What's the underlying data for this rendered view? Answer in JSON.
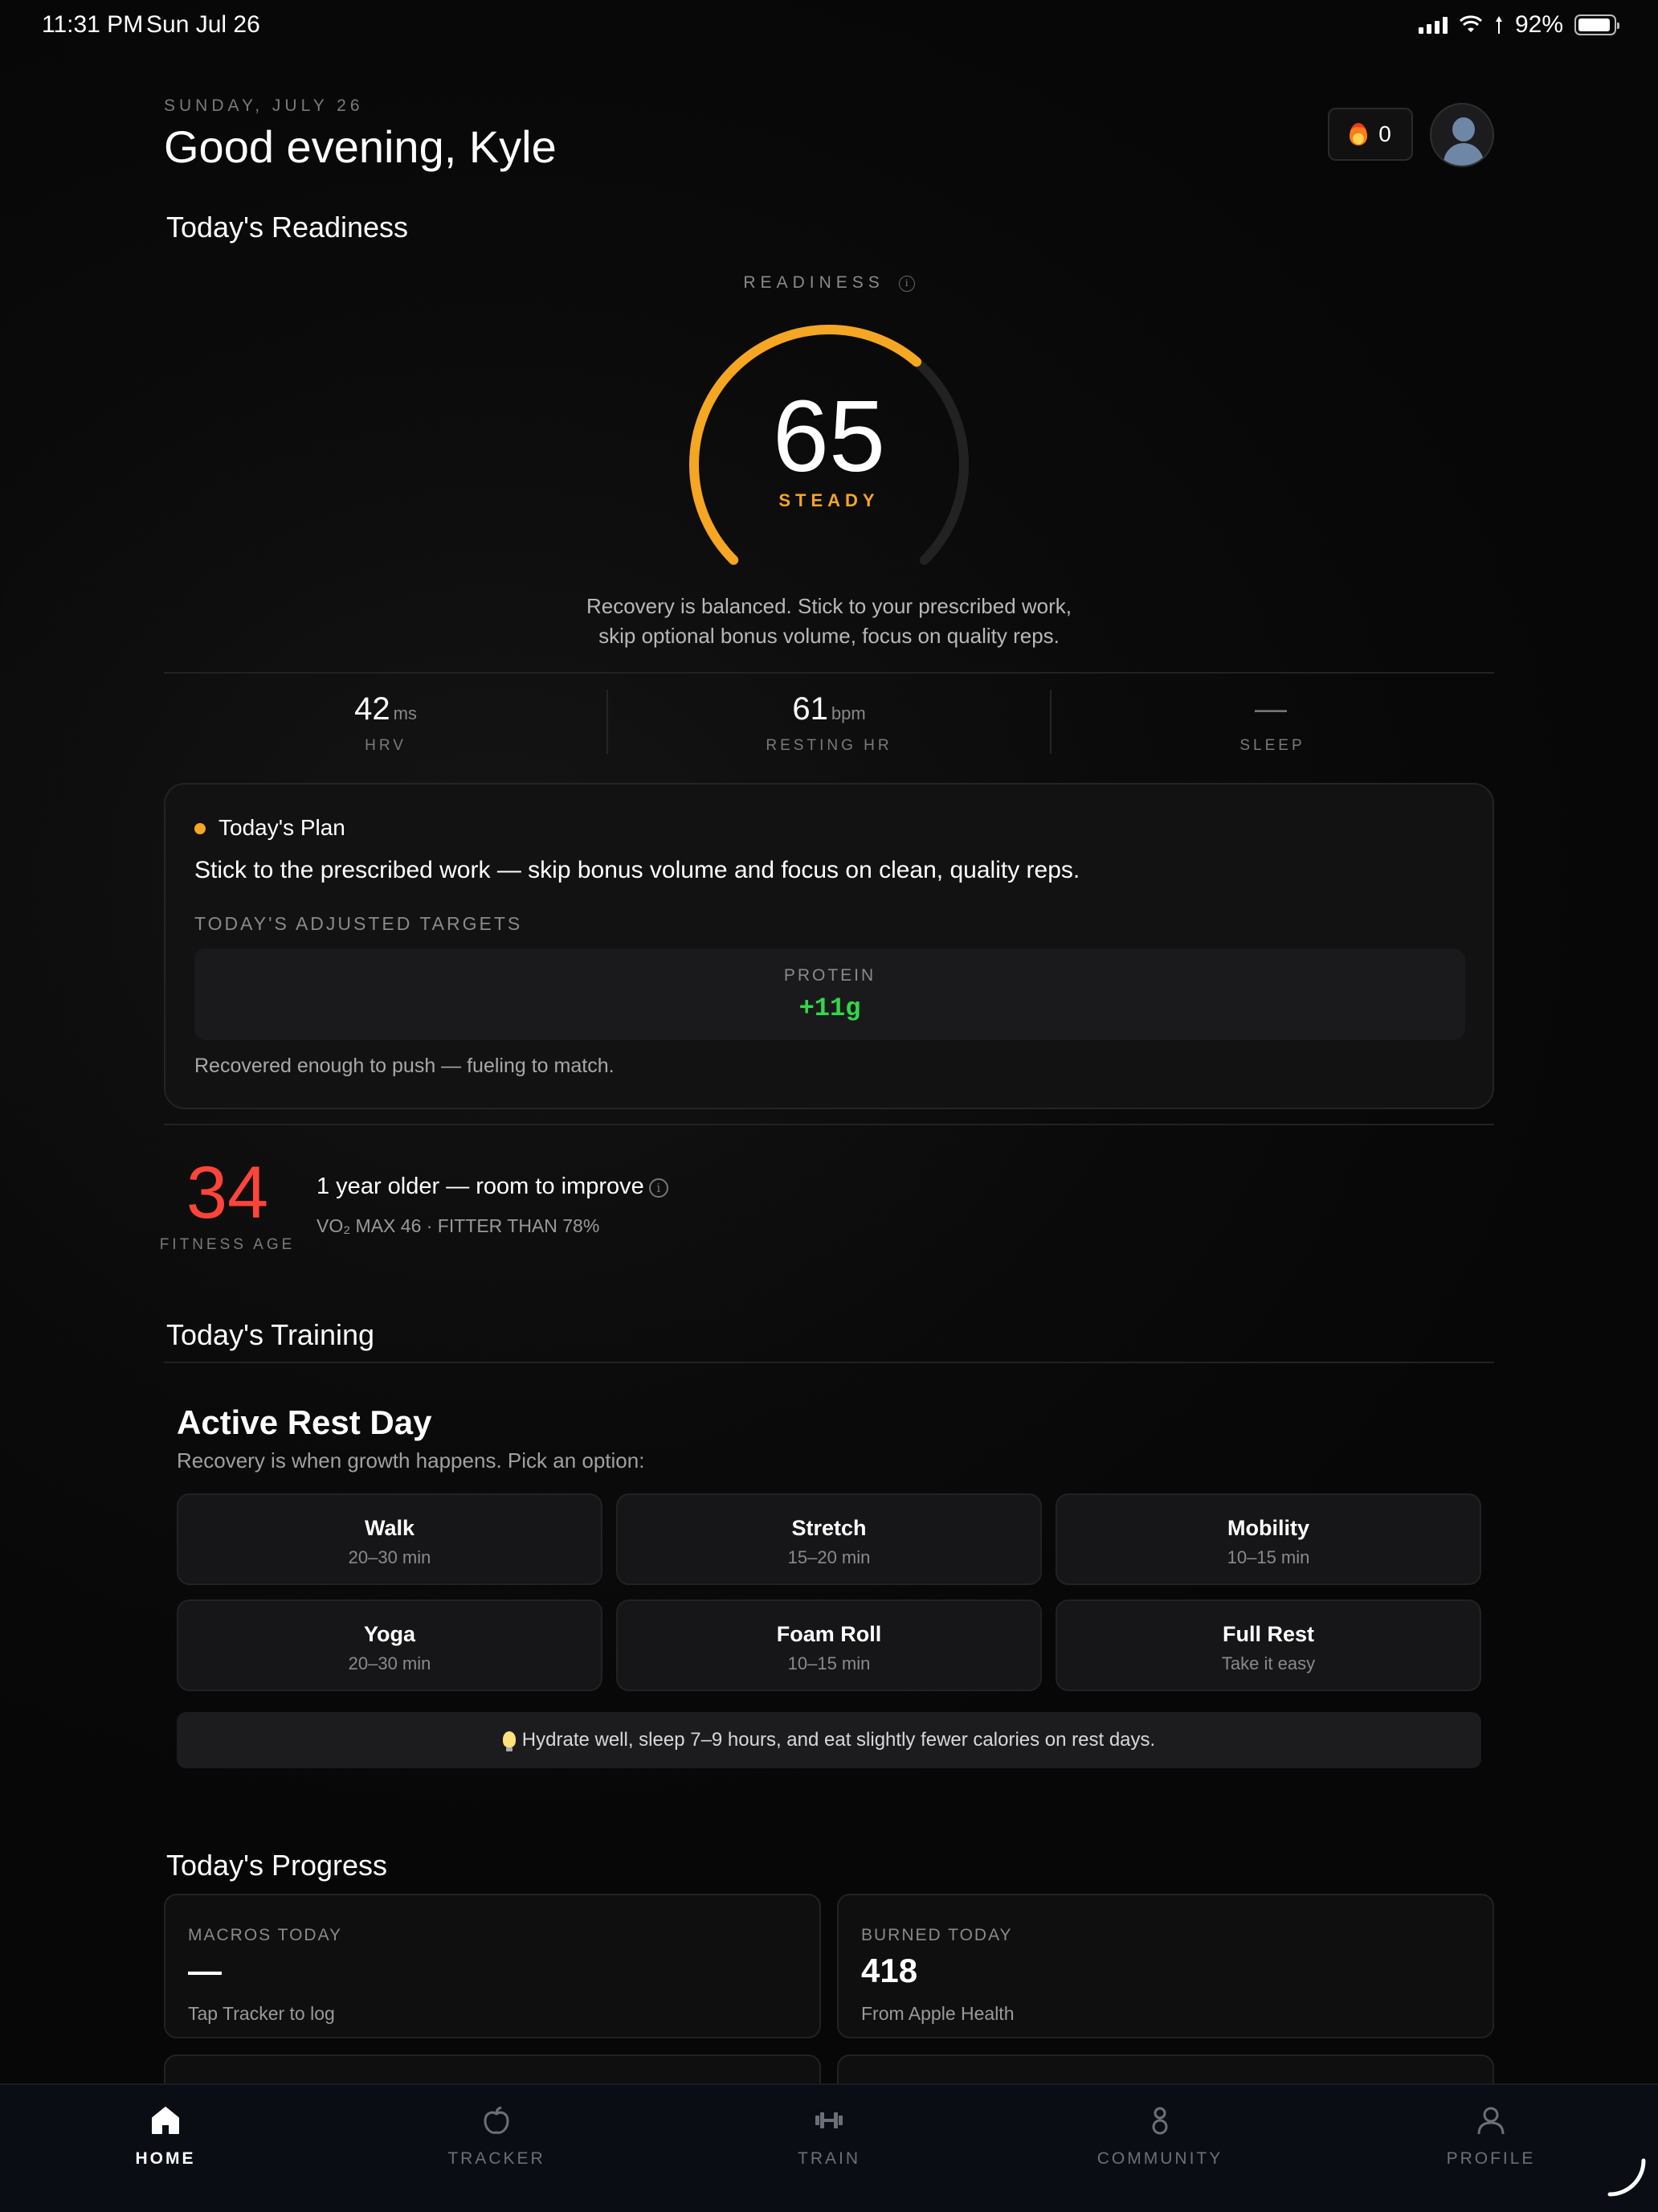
{
  "status_bar": {
    "time": "11:31 PM",
    "date": "Sun Jul 26",
    "battery": "92%",
    "battery_level": 0.92
  },
  "header": {
    "date": "SUNDAY, JULY 26",
    "greeting": "Good evening, Kyle",
    "streak": "0"
  },
  "readiness": {
    "section_title": "Today's Readiness",
    "label": "READINESS",
    "score": "65",
    "score_fraction": 0.65,
    "status": "STEADY",
    "message_line1": "Recovery is balanced. Stick to your prescribed work,",
    "message_line2": "skip optional bonus volume, focus on quality reps.",
    "accent_color": "#f5a623"
  },
  "metrics": [
    {
      "value": "42",
      "unit": "ms",
      "label": "HRV"
    },
    {
      "value": "61",
      "unit": "bpm",
      "label": "RESTING HR"
    },
    {
      "value": "—",
      "unit": "",
      "label": "SLEEP"
    }
  ],
  "plan": {
    "title": "Today's Plan",
    "text": "Stick to the prescribed work — skip bonus volume and focus on clean, quality reps.",
    "targets_label": "TODAY'S ADJUSTED TARGETS",
    "target_name": "PROTEIN",
    "target_value": "+11g",
    "footer": "Recovered enough to push — fueling to match."
  },
  "fitness": {
    "age": "34",
    "label": "FITNESS AGE",
    "title": "1 year older — room to improve",
    "subtitle": "VO₂ MAX 46 · FITTER THAN 78%"
  },
  "training": {
    "section_title": "Today's Training",
    "title": "Active Rest Day",
    "subtitle": "Recovery is when growth happens. Pick an option:",
    "options": [
      {
        "name": "Walk",
        "duration": "20–30 min"
      },
      {
        "name": "Stretch",
        "duration": "15–20 min"
      },
      {
        "name": "Mobility",
        "duration": "10–15 min"
      },
      {
        "name": "Yoga",
        "duration": "20–30 min"
      },
      {
        "name": "Foam Roll",
        "duration": "10–15 min"
      },
      {
        "name": "Full Rest",
        "duration": "Take it easy"
      }
    ],
    "tip": "Hydrate well, sleep 7–9 hours, and eat slightly fewer calories on rest days."
  },
  "progress": {
    "section_title": "Today's Progress",
    "cards": [
      {
        "label": "MACROS TODAY",
        "value": "—",
        "sub": "Tap Tracker to log"
      },
      {
        "label": "BURNED TODAY",
        "value": "418",
        "sub": "From Apple Health"
      }
    ]
  },
  "tabs": [
    {
      "label": "HOME",
      "icon": "home-icon"
    },
    {
      "label": "TRACKER",
      "icon": "apple-icon"
    },
    {
      "label": "TRAIN",
      "icon": "dumbbell-icon"
    },
    {
      "label": "COMMUNITY",
      "icon": "community-icon"
    },
    {
      "label": "PROFILE",
      "icon": "profile-icon"
    }
  ]
}
